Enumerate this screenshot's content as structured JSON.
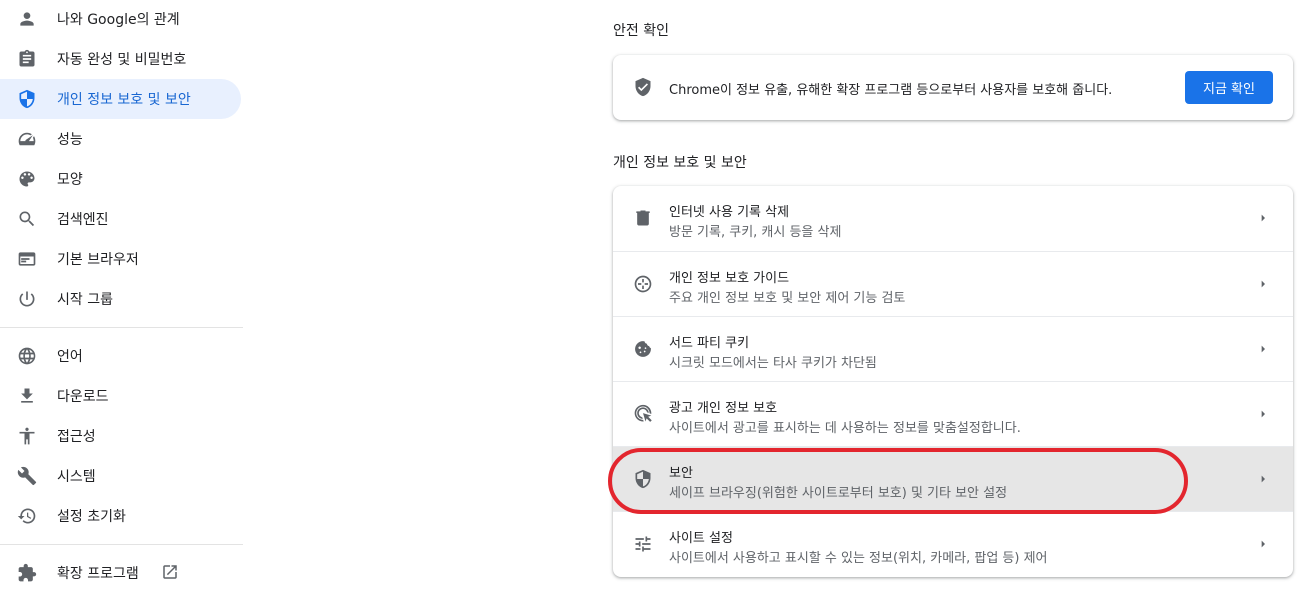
{
  "sidebar": {
    "items": [
      {
        "label": "나와 Google의 관계",
        "icon": "person-icon"
      },
      {
        "label": "자동 완성 및 비밀번호",
        "icon": "clipboard-icon"
      },
      {
        "label": "개인 정보 보호 및 보안",
        "icon": "shield-icon",
        "active": true
      },
      {
        "label": "성능",
        "icon": "speedometer-icon"
      },
      {
        "label": "모양",
        "icon": "palette-icon"
      },
      {
        "label": "검색엔진",
        "icon": "search-icon"
      },
      {
        "label": "기본 브라우저",
        "icon": "browser-window-icon"
      },
      {
        "label": "시작 그룹",
        "icon": "power-icon"
      },
      {
        "label": "언어",
        "icon": "globe-icon"
      },
      {
        "label": "다운로드",
        "icon": "download-icon"
      },
      {
        "label": "접근성",
        "icon": "accessibility-icon"
      },
      {
        "label": "시스템",
        "icon": "wrench-icon"
      },
      {
        "label": "설정 초기화",
        "icon": "history-icon"
      },
      {
        "label": "확장 프로그램",
        "icon": "puzzle-icon"
      }
    ]
  },
  "safety_check": {
    "title": "안전 확인",
    "description": "Chrome이 정보 유출, 유해한 확장 프로그램 등으로부터 사용자를 보호해 줍니다.",
    "button_label": "지금 확인",
    "icon": "shield-check-icon"
  },
  "privacy": {
    "title": "개인 정보 보호 및 보안",
    "rows": [
      {
        "title": "인터넷 사용 기록 삭제",
        "subtitle": "방문 기록, 쿠키, 캐시 등을 삭제",
        "icon": "trash-icon"
      },
      {
        "title": "개인 정보 보호 가이드",
        "subtitle": "주요 개인 정보 보호 및 보안 제어 기능 검토",
        "icon": "compass-icon"
      },
      {
        "title": "서드 파티 쿠키",
        "subtitle": "시크릿 모드에서는 타사 쿠키가 차단됨",
        "icon": "cookie-icon"
      },
      {
        "title": "광고 개인 정보 보호",
        "subtitle": "사이트에서 광고를 표시하는 데 사용하는 정보를 맞춤설정합니다.",
        "icon": "ads-click-icon"
      },
      {
        "title": "보안",
        "subtitle": "세이프 브라우징(위험한 사이트로부터 보호) 및 기타 보안 설정",
        "icon": "shield-icon",
        "highlighted": true
      },
      {
        "title": "사이트 설정",
        "subtitle": "사이트에서 사용하고 표시할 수 있는 정보(위치, 카메라, 팝업 등) 제어",
        "icon": "tune-icon"
      }
    ]
  },
  "colors": {
    "accent": "#1a73e8",
    "active_bg": "#e8f0fe",
    "annotation": "#e3262e",
    "highlight_bg": "#e6e6e6"
  }
}
